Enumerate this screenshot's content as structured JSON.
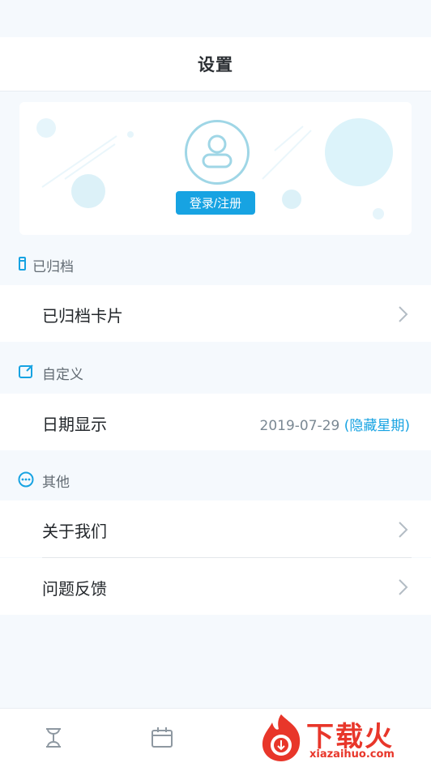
{
  "header": {
    "title": "设置"
  },
  "profile": {
    "login_label": "登录/注册"
  },
  "sections": {
    "archived": {
      "title": "已归档",
      "rows": [
        {
          "label": "已归档卡片"
        }
      ]
    },
    "custom": {
      "title": "自定义",
      "rows": [
        {
          "label": "日期显示",
          "value": "2019-07-29",
          "value_accent": "(隐藏星期)"
        }
      ]
    },
    "other": {
      "title": "其他",
      "rows": [
        {
          "label": "关于我们"
        },
        {
          "label": "问题反馈"
        }
      ]
    }
  },
  "watermark": {
    "title": "下载火",
    "domain": "xiazaihuo.com"
  },
  "colors": {
    "accent": "#17a3e2",
    "background": "#f5f9fd",
    "watermark": "#e8362a"
  },
  "icons": {
    "archived": "archive-icon",
    "custom": "edit-icon",
    "other": "more-icon",
    "tab1": "hourglass-icon",
    "tab2": "calendar-icon"
  }
}
